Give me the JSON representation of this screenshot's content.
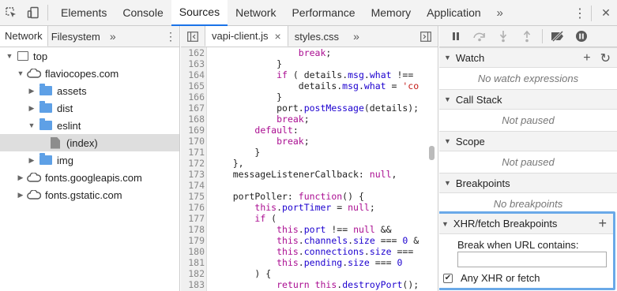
{
  "toolbar": {
    "tabs": [
      "Elements",
      "Console",
      "Sources",
      "Network",
      "Performance",
      "Memory",
      "Application"
    ],
    "active_tab": "Sources",
    "more_glyph": "»",
    "menu_glyph": "⋮",
    "close_glyph": "✕"
  },
  "navigator": {
    "tabs": [
      "Network",
      "Filesystem"
    ],
    "more_glyph": "»",
    "menu_glyph": "⋮",
    "tree": [
      {
        "label": "top",
        "kind": "frame",
        "depth": 0,
        "expanded": true
      },
      {
        "label": "flaviocopes.com",
        "kind": "cloud",
        "depth": 1,
        "expanded": true
      },
      {
        "label": "assets",
        "kind": "folder",
        "depth": 2,
        "expanded": false
      },
      {
        "label": "dist",
        "kind": "folder",
        "depth": 2,
        "expanded": false
      },
      {
        "label": "eslint",
        "kind": "folder",
        "depth": 2,
        "expanded": true
      },
      {
        "label": "(index)",
        "kind": "file",
        "depth": 3,
        "selected": true
      },
      {
        "label": "img",
        "kind": "folder",
        "depth": 2,
        "expanded": false
      },
      {
        "label": "fonts.googleapis.com",
        "kind": "cloud",
        "depth": 1,
        "expanded": false
      },
      {
        "label": "fonts.gstatic.com",
        "kind": "cloud",
        "depth": 1,
        "expanded": false
      }
    ]
  },
  "editor": {
    "tabs": [
      "vapi-client.js",
      "styles.css"
    ],
    "active_tab": "vapi-client.js",
    "close_glyph": "×",
    "more_glyph": "»",
    "lines": [
      {
        "n": "162",
        "text": "                break;"
      },
      {
        "n": "163",
        "text": "            }"
      },
      {
        "n": "164",
        "text": "            if ( details.msg.what !== "
      },
      {
        "n": "165",
        "text": "                details.msg.what = 'co"
      },
      {
        "n": "166",
        "text": "            }"
      },
      {
        "n": "167",
        "text": "            port.postMessage(details);"
      },
      {
        "n": "168",
        "text": "            break;"
      },
      {
        "n": "169",
        "text": "        default:"
      },
      {
        "n": "170",
        "text": "            break;"
      },
      {
        "n": "171",
        "text": "        }"
      },
      {
        "n": "172",
        "text": "    },"
      },
      {
        "n": "173",
        "text": "    messageListenerCallback: null,"
      },
      {
        "n": "174",
        "text": ""
      },
      {
        "n": "175",
        "text": "    portPoller: function() {"
      },
      {
        "n": "176",
        "text": "        this.portTimer = null;"
      },
      {
        "n": "177",
        "text": "        if ("
      },
      {
        "n": "178",
        "text": "            this.port !== null &&"
      },
      {
        "n": "179",
        "text": "            this.channels.size === 0 &"
      },
      {
        "n": "180",
        "text": "            this.connections.size ==="
      },
      {
        "n": "181",
        "text": "            this.pending.size === 0"
      },
      {
        "n": "182",
        "text": "        ) {"
      },
      {
        "n": "183",
        "text": "            return this.destroyPort();"
      }
    ]
  },
  "debugger": {
    "sections": [
      {
        "title": "Watch",
        "body": "No watch expressions",
        "actions": [
          "+",
          "↻"
        ]
      },
      {
        "title": "Call Stack",
        "body": "Not paused"
      },
      {
        "title": "Scope",
        "body": "Not paused"
      },
      {
        "title": "Breakpoints",
        "body": "No breakpoints"
      }
    ],
    "xhr": {
      "title": "XHR/fetch Breakpoints",
      "add_glyph": "+",
      "break_label": "Break when URL contains:",
      "input_value": "",
      "input_placeholder": "",
      "any_label": "Any XHR or fetch",
      "any_checked": true,
      "check_glyph": "✔"
    }
  },
  "colors": {
    "accent": "#1a73e8",
    "highlight_border": "#6aa9e8",
    "folder": "#5ea0e6"
  }
}
